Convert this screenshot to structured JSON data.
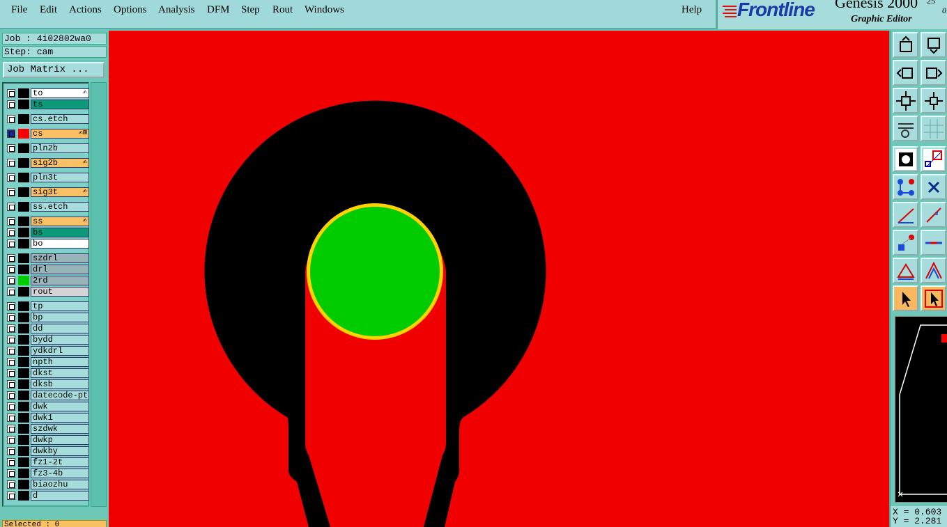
{
  "menu": [
    "File",
    "Edit",
    "Actions",
    "Options",
    "Analysis",
    "DFM",
    "Step",
    "Rout",
    "Windows"
  ],
  "help": "Help",
  "logo": {
    "brand": "Frontline",
    "product": "Genesis 2000",
    "sup1": "25",
    "sup2": "0",
    "subtitle": "Graphic Editor"
  },
  "job": "Job : 4i02802wa0",
  "step": "Step: cam",
  "job_matrix": "Job Matrix ...",
  "layers": [
    {
      "name": "to",
      "style": "white",
      "color": "#000000",
      "hint": "✍"
    },
    {
      "name": "ts",
      "style": "teal",
      "color": "#000000",
      "hint": ""
    },
    {
      "name": "cs.etch",
      "style": "",
      "color": "#000000",
      "hint": ""
    },
    {
      "name": "cs",
      "style": "yellow",
      "color": "#ff0000",
      "hint": "✍⊞"
    },
    {
      "name": "pln2b",
      "style": "",
      "color": "#000000",
      "hint": ""
    },
    {
      "name": "sig2b",
      "style": "yellow",
      "color": "#000000",
      "hint": "✍"
    },
    {
      "name": "pln3t",
      "style": "",
      "color": "#000000",
      "hint": ""
    },
    {
      "name": "sig3t",
      "style": "yellow",
      "color": "#000000",
      "hint": "✍"
    },
    {
      "name": "ss.etch",
      "style": "",
      "color": "#000000",
      "hint": ""
    },
    {
      "name": "ss",
      "style": "yellow",
      "color": "#000000",
      "hint": "✍"
    },
    {
      "name": "bs",
      "style": "teal",
      "color": "#000000",
      "hint": ""
    },
    {
      "name": "bo",
      "style": "white",
      "color": "#000000",
      "hint": ""
    },
    {
      "name": "szdrl",
      "style": "gray",
      "color": "#000000",
      "hint": ""
    },
    {
      "name": "drl",
      "style": "gray",
      "color": "#000000",
      "hint": ""
    },
    {
      "name": "2rd",
      "style": "gray",
      "color": "#00cc00",
      "hint": ""
    },
    {
      "name": "rout",
      "style": "lgray",
      "color": "#000000",
      "hint": ""
    },
    {
      "name": "tp",
      "style": "",
      "color": "#000000",
      "hint": ""
    },
    {
      "name": "bp",
      "style": "",
      "color": "#000000",
      "hint": ""
    },
    {
      "name": "dd",
      "style": "",
      "color": "#000000",
      "hint": ""
    },
    {
      "name": "bydd",
      "style": "",
      "color": "#000000",
      "hint": ""
    },
    {
      "name": "ydkdrl",
      "style": "",
      "color": "#000000",
      "hint": ""
    },
    {
      "name": "npth",
      "style": "",
      "color": "#000000",
      "hint": ""
    },
    {
      "name": "dkst",
      "style": "",
      "color": "#000000",
      "hint": ""
    },
    {
      "name": "dksb",
      "style": "",
      "color": "#000000",
      "hint": ""
    },
    {
      "name": "datecode-pt",
      "style": "",
      "color": "#000000",
      "hint": ""
    },
    {
      "name": "dwk",
      "style": "",
      "color": "#000000",
      "hint": ""
    },
    {
      "name": "dwk1",
      "style": "",
      "color": "#000000",
      "hint": ""
    },
    {
      "name": "szdwk",
      "style": "",
      "color": "#000000",
      "hint": ""
    },
    {
      "name": "dwkp",
      "style": "",
      "color": "#000000",
      "hint": ""
    },
    {
      "name": "dwkby",
      "style": "",
      "color": "#000000",
      "hint": ""
    },
    {
      "name": "fz1-2t",
      "style": "",
      "color": "#000000",
      "hint": ""
    },
    {
      "name": "fz3-4b",
      "style": "",
      "color": "#000000",
      "hint": ""
    },
    {
      "name": "biaozhu",
      "style": "",
      "color": "#000000",
      "hint": ""
    },
    {
      "name": "d",
      "style": "",
      "color": "#000000",
      "hint": ""
    }
  ],
  "selected": "Selected : 0",
  "coords": {
    "x": "X = 0.603",
    "y": "Y = 2.281"
  },
  "colors": {
    "board": "#f00000",
    "pad": "#000000",
    "drill": "#00cc00",
    "ring": "#ffd200"
  }
}
